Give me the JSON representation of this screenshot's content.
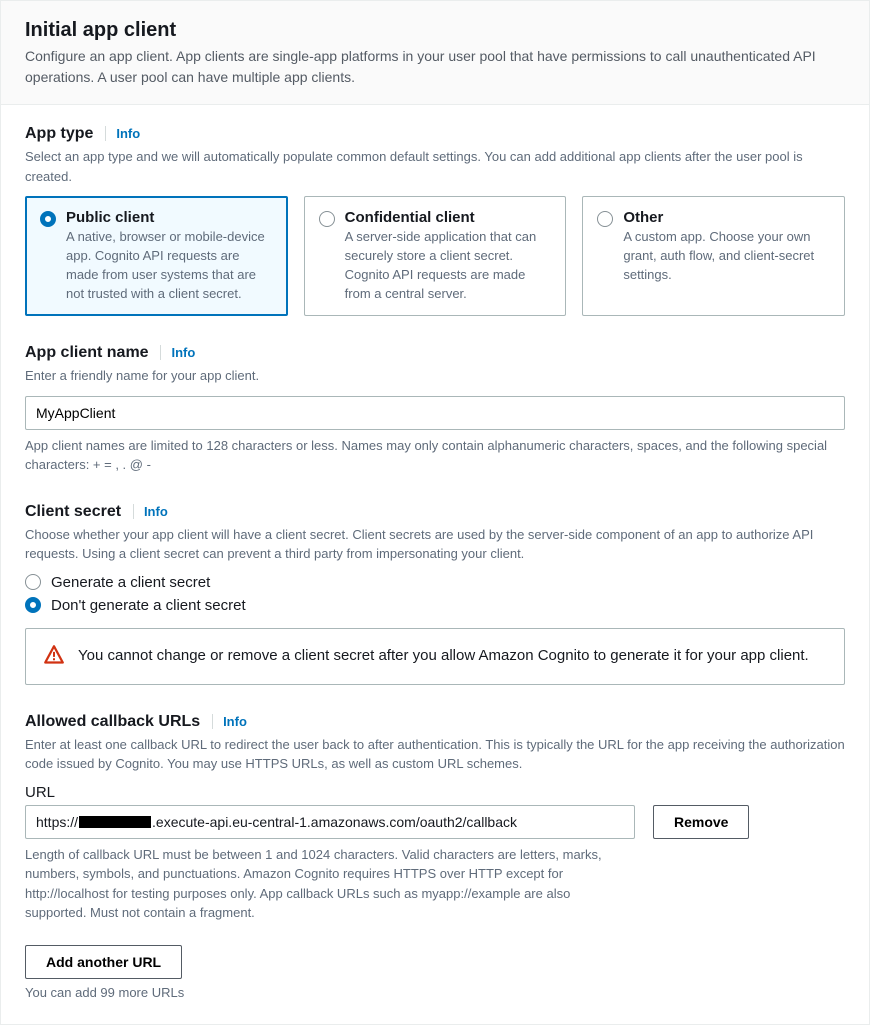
{
  "header": {
    "title": "Initial app client",
    "subtitle": "Configure an app client. App clients are single-app platforms in your user pool that have permissions to call unauthenticated API operations. A user pool can have multiple app clients."
  },
  "infoLabel": "Info",
  "appType": {
    "title": "App type",
    "helper": "Select an app type and we will automatically populate common default settings. You can add additional app clients after the user pool is created.",
    "tiles": [
      {
        "title": "Public client",
        "desc": "A native, browser or mobile-device app. Cognito API requests are made from user systems that are not trusted with a client secret.",
        "selected": true
      },
      {
        "title": "Confidential client",
        "desc": "A server-side application that can securely store a client secret. Cognito API requests are made from a central server.",
        "selected": false
      },
      {
        "title": "Other",
        "desc": "A custom app. Choose your own grant, auth flow, and client-secret settings.",
        "selected": false
      }
    ]
  },
  "appClientName": {
    "title": "App client name",
    "helper": "Enter a friendly name for your app client.",
    "value": "MyAppClient",
    "constraint": "App client names are limited to 128 characters or less. Names may only contain alphanumeric characters, spaces, and the following special characters: + = , . @ -"
  },
  "clientSecret": {
    "title": "Client secret",
    "helper": "Choose whether your app client will have a client secret. Client secrets are used by the server-side component of an app to authorize API requests. Using a client secret can prevent a third party from impersonating your client.",
    "options": [
      {
        "label": "Generate a client secret",
        "selected": false
      },
      {
        "label": "Don't generate a client secret",
        "selected": true
      }
    ],
    "warning": "You cannot change or remove a client secret after you allow Amazon Cognito to generate it for your app client."
  },
  "callbackUrls": {
    "title": "Allowed callback URLs",
    "helper": "Enter at least one callback URL to redirect the user back to after authentication. This is typically the URL for the app receiving the authorization code issued by Cognito. You may use HTTPS URLs, as well as custom URL schemes.",
    "fieldLabel": "URL",
    "url_prefix": "https://",
    "url_suffix": ".execute-api.eu-central-1.amazonaws.com/oauth2/callback",
    "removeLabel": "Remove",
    "constraint": "Length of callback URL must be between 1 and 1024 characters. Valid characters are letters, marks, numbers, symbols, and punctuations. Amazon Cognito requires HTTPS over HTTP except for http://localhost for testing purposes only. App callback URLs such as myapp://example are also supported. Must not contain a fragment.",
    "addLabel": "Add another URL",
    "addNote": "You can add 99 more URLs"
  }
}
